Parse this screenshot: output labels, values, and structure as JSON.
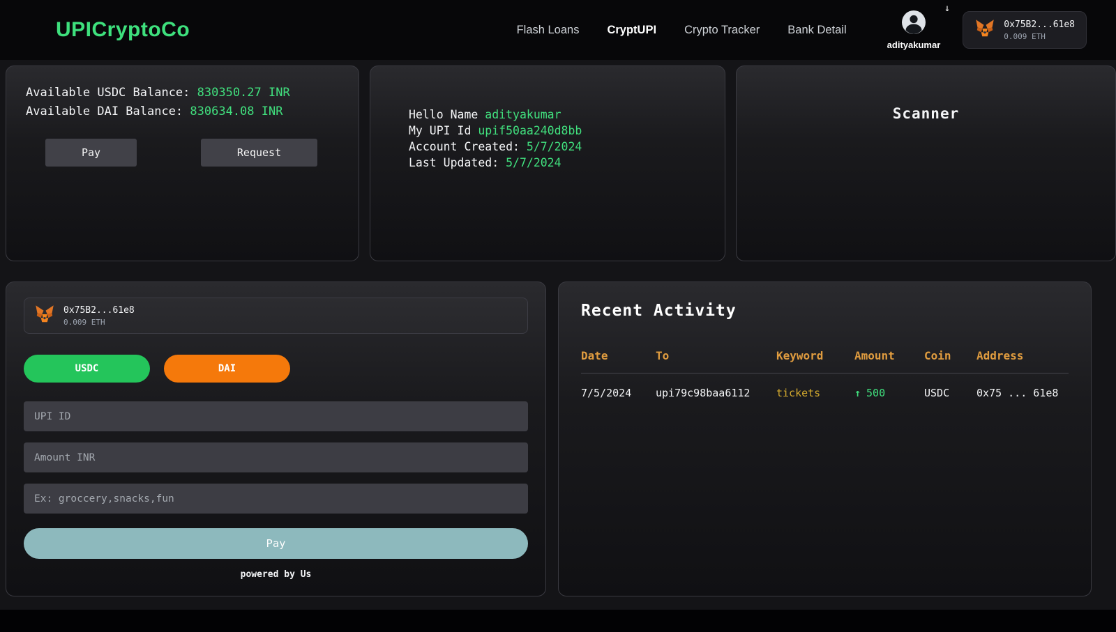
{
  "header": {
    "logo": "UPICryptoCo",
    "nav": [
      {
        "label": "Flash Loans"
      },
      {
        "label": "CryptUPI"
      },
      {
        "label": "Crypto Tracker"
      },
      {
        "label": "Bank Detail"
      }
    ],
    "user": {
      "name": "adityakumar"
    },
    "wallet": {
      "address": "0x75B2...61e8",
      "balance": "0.009 ETH"
    }
  },
  "balances": {
    "usdc_label": "Available USDC Balance: ",
    "usdc_value": "830350.27 INR",
    "dai_label": "Available DAI Balance: ",
    "dai_value": "830634.08 INR",
    "pay_button": "Pay",
    "request_button": "Request"
  },
  "account": {
    "hello_label": "Hello Name ",
    "name": "adityakumar",
    "upi_label": "My UPI Id ",
    "upi_id": "upif50aa240d8bb",
    "created_label": "Account Created: ",
    "created_date": "5/7/2024",
    "updated_label": "Last Updated: ",
    "updated_date": "5/7/2024"
  },
  "scanner": {
    "title": "Scanner"
  },
  "payment": {
    "wallet": {
      "address": "0x75B2...61e8",
      "balance": "0.009 ETH"
    },
    "coins": {
      "usdc": "USDC",
      "dai": "DAI"
    },
    "upi_placeholder": "UPI ID",
    "amount_placeholder": "Amount INR",
    "keyword_placeholder": "Ex: groccery,snacks,fun",
    "pay_button": "Pay",
    "powered_by": "powered by Us"
  },
  "activity": {
    "title": "Recent Activity",
    "columns": [
      "Date",
      "To",
      "Keyword",
      "Amount",
      "Coin",
      "Address"
    ],
    "rows": [
      {
        "date": "7/5/2024",
        "to": "upi79c98baa6112",
        "keyword": "tickets",
        "arrow": "↑",
        "amount": "500",
        "coin": "USDC",
        "address": "0x75 ... 61e8"
      }
    ]
  },
  "colors": {
    "accent_green": "#41e07e",
    "usdc_green": "#24c55b",
    "dai_orange": "#f5790b",
    "table_header_orange": "#e09c3f",
    "keyword_yellow": "#d4aa2e",
    "pay_teal": "#8db9bd"
  }
}
